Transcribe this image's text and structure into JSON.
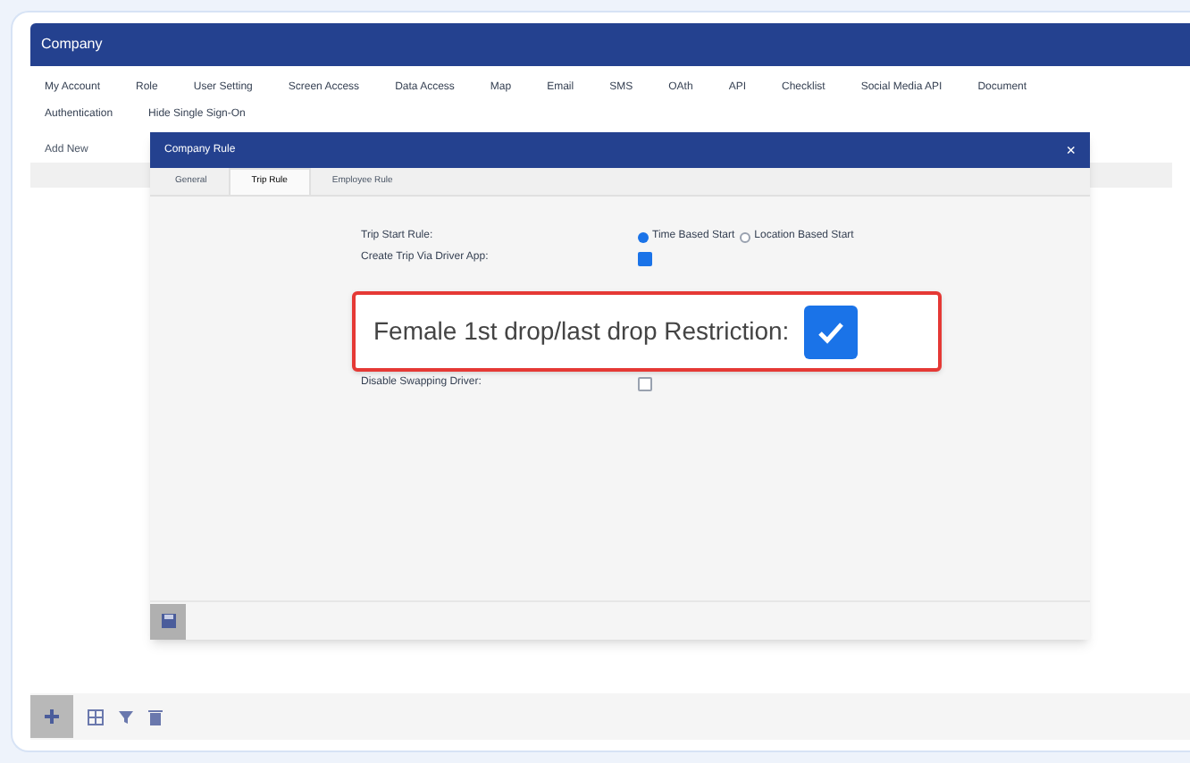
{
  "window": {
    "title": "Company"
  },
  "tabs": [
    {
      "label": "My Account",
      "selected": false
    },
    {
      "label": "Role",
      "selected": false
    },
    {
      "label": "User Setting",
      "selected": false
    },
    {
      "label": "Screen Access",
      "selected": false
    },
    {
      "label": "Data Access",
      "selected": false
    },
    {
      "label": "Map",
      "selected": false
    },
    {
      "label": "Email",
      "selected": false
    },
    {
      "label": "SMS",
      "selected": false
    },
    {
      "label": "OAth",
      "selected": false
    },
    {
      "label": "API",
      "selected": false
    },
    {
      "label": "Checklist",
      "selected": false
    },
    {
      "label": "Social Media API",
      "selected": false
    },
    {
      "label": "Document",
      "selected": false
    },
    {
      "label": "Authentication",
      "selected": false
    },
    {
      "label": "Hide Single Sign-On",
      "selected": false
    }
  ],
  "filter_label": "Add New",
  "dialog": {
    "title": "Company Rule",
    "close": "×",
    "tabs": [
      {
        "label": "General",
        "selected": false
      },
      {
        "label": "Trip Rule",
        "selected": true
      },
      {
        "label": "Employee Rule",
        "selected": false
      }
    ],
    "rows": [
      {
        "kind": "radio",
        "label": "Trip Start Rule:",
        "options": [
          {
            "label": "Time Based Start",
            "selected": true
          },
          {
            "label": "Location Based Start",
            "selected": false
          }
        ]
      },
      {
        "kind": "checkbox",
        "label": "Create Trip Via Driver App:",
        "checked": true
      },
      {
        "kind": "checkbox",
        "label": "Disable Swapping Driver:",
        "checked": false
      }
    ]
  },
  "callout": {
    "label": "Female 1st drop/last drop Restriction:",
    "checked": true
  }
}
